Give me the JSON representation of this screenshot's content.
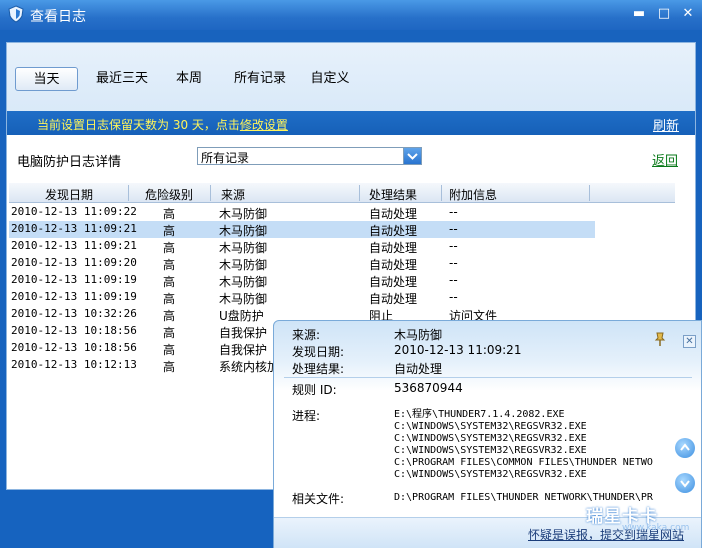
{
  "window": {
    "title": "查看日志"
  },
  "tabs": [
    "当天",
    "最近三天",
    "本周",
    "所有记录",
    "自定义"
  ],
  "notice": {
    "text": "当前设置日志保留天数为 30 天，点击",
    "link": "修改设置"
  },
  "refresh_label": "刷新",
  "detail": {
    "label": "电脑防护日志详情",
    "select_value": "所有记录",
    "back_label": "返回"
  },
  "table": {
    "headers": [
      "发现日期",
      "危险级别",
      "来源",
      "处理结果",
      "附加信息"
    ],
    "rows": [
      {
        "date": "2010-12-13 11:09:22",
        "level": "高",
        "source": "木马防御",
        "result": "自动处理",
        "info": "--"
      },
      {
        "date": "2010-12-13 11:09:21",
        "level": "高",
        "source": "木马防御",
        "result": "自动处理",
        "info": "--"
      },
      {
        "date": "2010-12-13 11:09:21",
        "level": "高",
        "source": "木马防御",
        "result": "自动处理",
        "info": "--"
      },
      {
        "date": "2010-12-13 11:09:20",
        "level": "高",
        "source": "木马防御",
        "result": "自动处理",
        "info": "--"
      },
      {
        "date": "2010-12-13 11:09:19",
        "level": "高",
        "source": "木马防御",
        "result": "自动处理",
        "info": "--"
      },
      {
        "date": "2010-12-13 11:09:19",
        "level": "高",
        "source": "木马防御",
        "result": "自动处理",
        "info": "--"
      },
      {
        "date": "2010-12-13 10:32:26",
        "level": "高",
        "source": "U盘防护",
        "result": "阻止",
        "info": "访问文件"
      },
      {
        "date": "2010-12-13 10:18:56",
        "level": "高",
        "source": "自我保护",
        "result": "",
        "info": ""
      },
      {
        "date": "2010-12-13 10:18:56",
        "level": "高",
        "source": "自我保护",
        "result": "",
        "info": ""
      },
      {
        "date": "2010-12-13 10:12:13",
        "level": "高",
        "source": "系统内核加",
        "result": "",
        "info": ""
      }
    ]
  },
  "popup": {
    "source_label": "来源:",
    "source_value": "木马防御",
    "date_label": "发现日期:",
    "date_value": "2010-12-13 11:09:21",
    "result_label": "处理结果:",
    "result_value": "自动处理",
    "rule_label": "规则 ID:",
    "rule_value": "536870944",
    "process_label": "进程:",
    "process_lines": [
      "E:\\程序\\THUNDER7.1.4.2082.EXE",
      "C:\\WINDOWS\\SYSTEM32\\REGSVR32.EXE",
      "C:\\WINDOWS\\SYSTEM32\\REGSVR32.EXE",
      "C:\\WINDOWS\\SYSTEM32\\REGSVR32.EXE",
      "C:\\PROGRAM FILES\\COMMON FILES\\THUNDER NETWO",
      "C:\\WINDOWS\\SYSTEM32\\REGSVR32.EXE"
    ],
    "file_label": "相关文件:",
    "file_value": "D:\\PROGRAM FILES\\THUNDER NETWORK\\THUNDER\\PR",
    "report_label": "怀疑是误报，提交到瑞星网站"
  },
  "watermark": {
    "main": "瑞星卡卡",
    "sub": "www.kaka.com"
  }
}
